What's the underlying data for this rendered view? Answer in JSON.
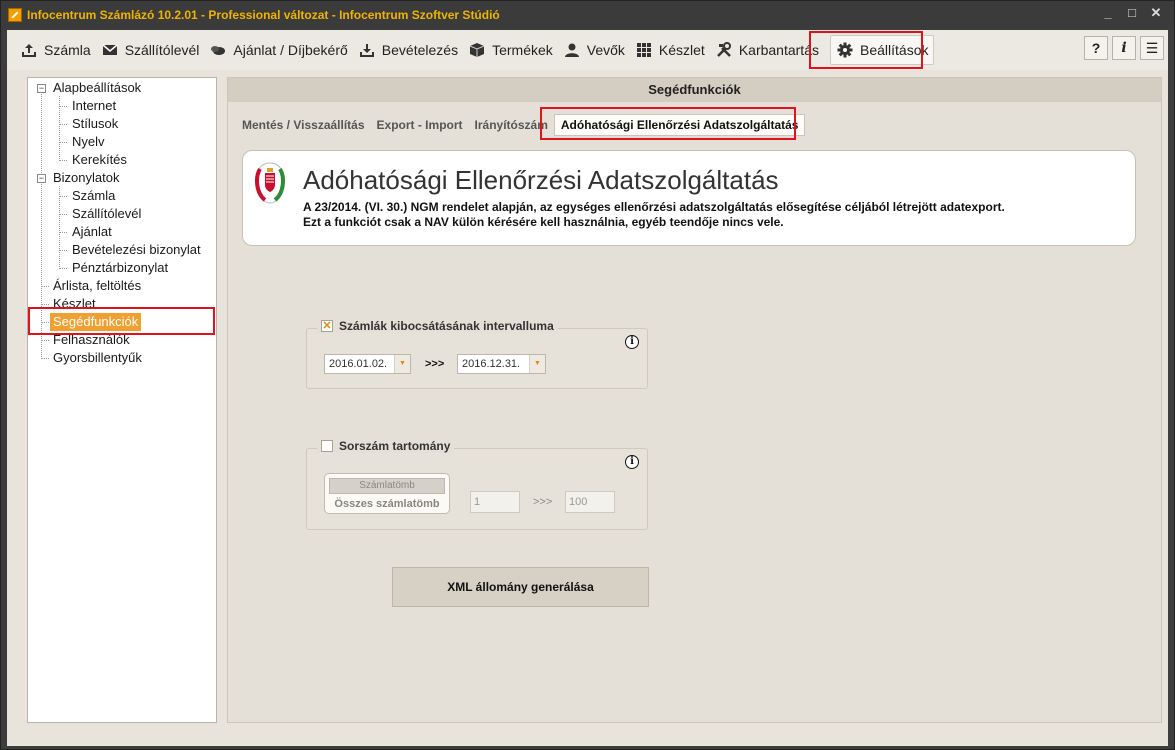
{
  "window": {
    "title": "Infocentrum Számlázó 10.2.01 - Professional változat - Infocentrum Szoftver Stúdió",
    "controls": [
      "_",
      "□",
      "✕"
    ]
  },
  "menu": [
    {
      "label": "Számla",
      "icon": "upload-icon"
    },
    {
      "label": "Szállítólevél",
      "icon": "envelope-icon"
    },
    {
      "label": "Ajánlat / Díjbekérő",
      "icon": "coins-icon"
    },
    {
      "label": "Bevételezés",
      "icon": "download-icon"
    },
    {
      "label": "Termékek",
      "icon": "box-icon"
    },
    {
      "label": "Vevők",
      "icon": "user-icon"
    },
    {
      "label": "Készlet",
      "icon": "grid-icon"
    },
    {
      "label": "Karbantartás",
      "icon": "tools-icon"
    },
    {
      "label": "Beállítások",
      "icon": "gear-icon"
    }
  ],
  "help_icons": [
    "?",
    "i",
    "☰"
  ],
  "tree": {
    "alapbeallitasok": "Alapbeállítások",
    "internet": "Internet",
    "stilusok": "Stílusok",
    "nyelv": "Nyelv",
    "kerekites": "Kerekítés",
    "bizonylatok": "Bizonylatok",
    "szamla": "Számla",
    "szallitolevel": "Szállítólevél",
    "ajanlat": "Ajánlat",
    "bevetelezesi": "Bevételezési bizonylat",
    "penztar": "Pénztárbizonylat",
    "arlista": "Árlista, feltöltés",
    "keszlet": "Készlet",
    "segedfunkciok": "Segédfunkciók",
    "felhasznalok": "Felhasználók",
    "gyorsbillentyuk": "Gyorsbillentyűk"
  },
  "section_title": "Segédfunkciók",
  "tabs": [
    "Mentés / Visszaállítás",
    "Export - Import",
    "Irányítószám",
    "Adóhatósági Ellenőrzési Adatszolgáltatás"
  ],
  "card": {
    "title": "Adóhatósági Ellenőrzési Adatszolgáltatás",
    "line1": "A 23/2014. (VI. 30.) NGM rendelet alapján, az egységes ellenőrzési adatszolgáltatás elősegítése céljából létrejött adatexport.",
    "line2": "Ezt a funkciót csak a NAV külön kérésére kell használnia, egyéb teendője nincs vele."
  },
  "interval": {
    "label": "Számlák kibocsátásának intervalluma",
    "checked": true,
    "from": "2016.01.02.",
    "to": "2016.12.31.",
    "arrows": ">>>",
    "info": "i"
  },
  "range": {
    "label": "Sorszám tartomány",
    "checked": false,
    "block_button": "Számlatömb",
    "block_label": "Összes számlatömb",
    "from": "1",
    "to": "100",
    "arrows": ">>>",
    "info": "i"
  },
  "generate_button": "XML állomány generálása",
  "colors": {
    "accent": "#f0a030",
    "highlight": "#e0121b",
    "title_text": "#f0b400"
  }
}
